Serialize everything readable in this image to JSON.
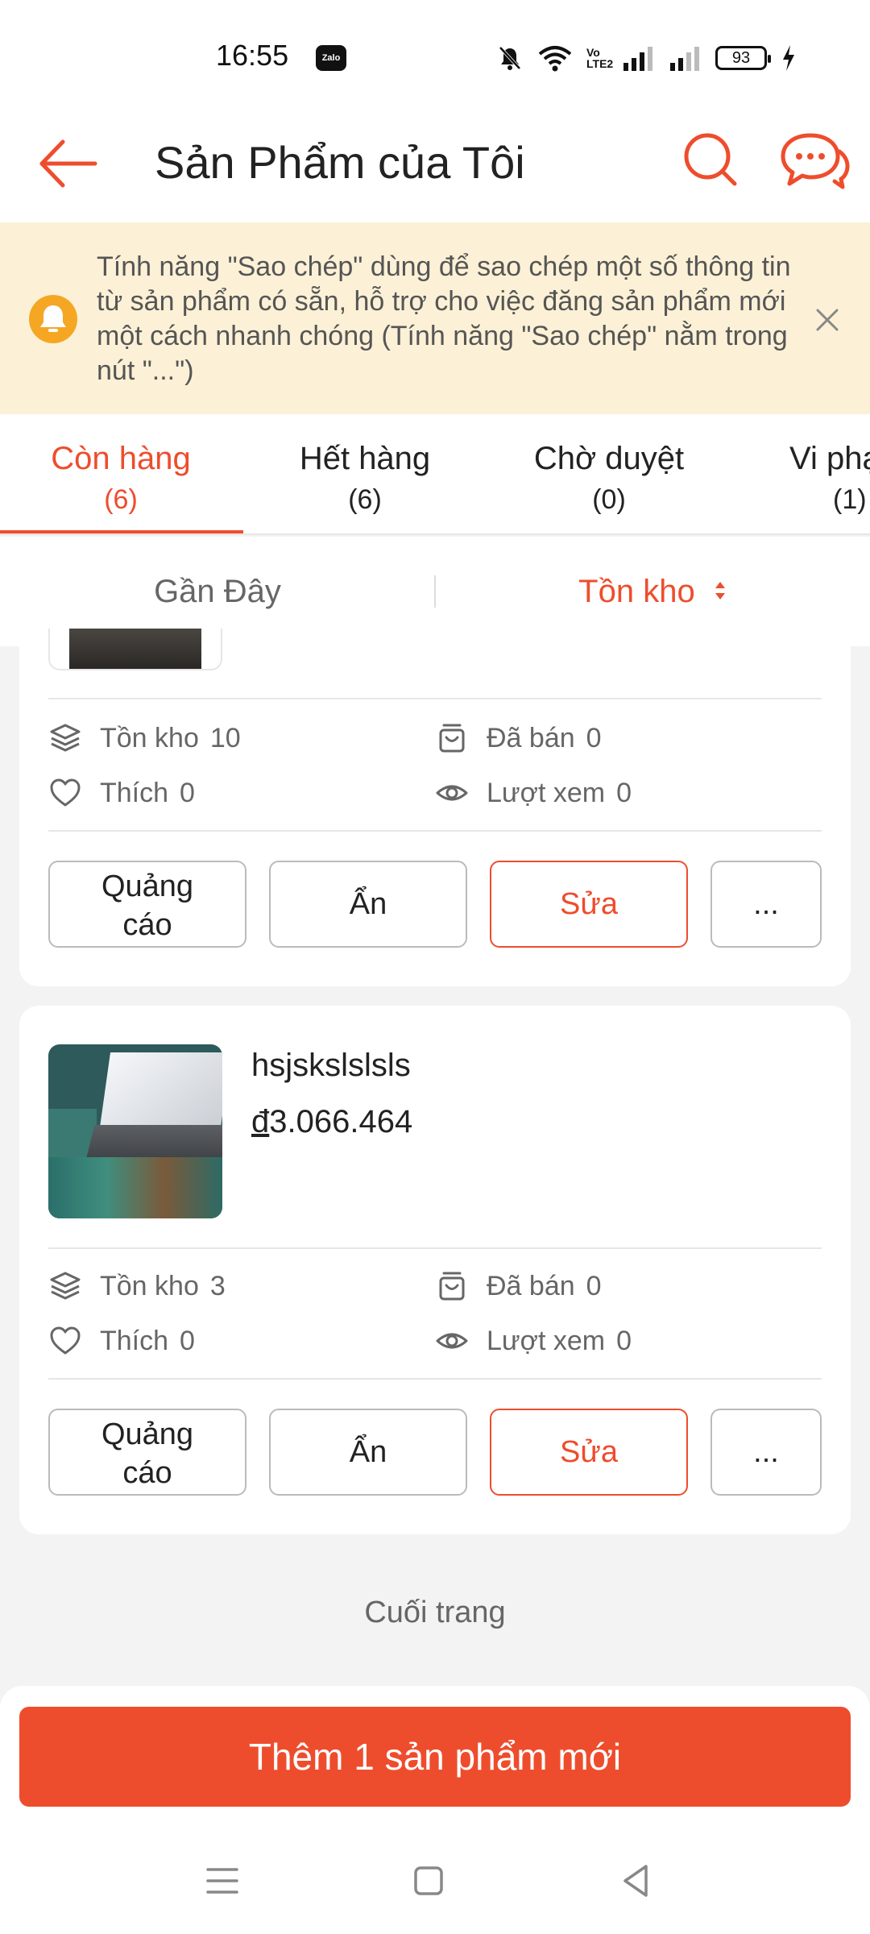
{
  "status_bar": {
    "time": "16:55",
    "zalo_label": "Zalo",
    "network_label": "Vo LTE2",
    "battery": "93"
  },
  "header": {
    "title": "Sản Phẩm của Tôi"
  },
  "notice": {
    "text": "Tính năng \"Sao chép\" dùng để sao chép một số thông tin từ sản phẩm có sẵn, hỗ trợ cho việc đăng sản phẩm mới một cách nhanh chóng (Tính năng \"Sao chép\" nằm trong nút \"...\")"
  },
  "tabs": [
    {
      "label": "Còn hàng",
      "count": "(6)",
      "active": true
    },
    {
      "label": "Hết hàng",
      "count": "(6)",
      "active": false
    },
    {
      "label": "Chờ duyệt",
      "count": "(0)",
      "active": false
    },
    {
      "label": "Vi phạm",
      "count": "(1)",
      "active": false
    }
  ],
  "sort": {
    "recent": "Gần Đây",
    "stock": "Tồn kho"
  },
  "products": [
    {
      "name": "",
      "price": "",
      "stock_label": "Tồn kho",
      "stock": "10",
      "sold_label": "Đã bán",
      "sold": "0",
      "likes_label": "Thích",
      "likes": "0",
      "views_label": "Lượt xem",
      "views": "0",
      "ad_line1": "Quảng",
      "ad_line2": "cáo",
      "hide": "Ẩn",
      "edit": "Sửa",
      "more": "..."
    },
    {
      "name": "hsjskslslsls",
      "price_currency": "đ",
      "price_value": "3.066.464",
      "stock_label": "Tồn kho",
      "stock": "3",
      "sold_label": "Đã bán",
      "sold": "0",
      "likes_label": "Thích",
      "likes": "0",
      "views_label": "Lượt xem",
      "views": "0",
      "ad_line1": "Quảng",
      "ad_line2": "cáo",
      "hide": "Ẩn",
      "edit": "Sửa",
      "more": "..."
    }
  ],
  "end_of_list": "Cuối trang",
  "add_product": "Thêm 1 sản phẩm mới",
  "colors": {
    "accent": "#ee4d2d",
    "notice_bg": "#fcf1d6",
    "notice_icon": "#f5a623"
  }
}
